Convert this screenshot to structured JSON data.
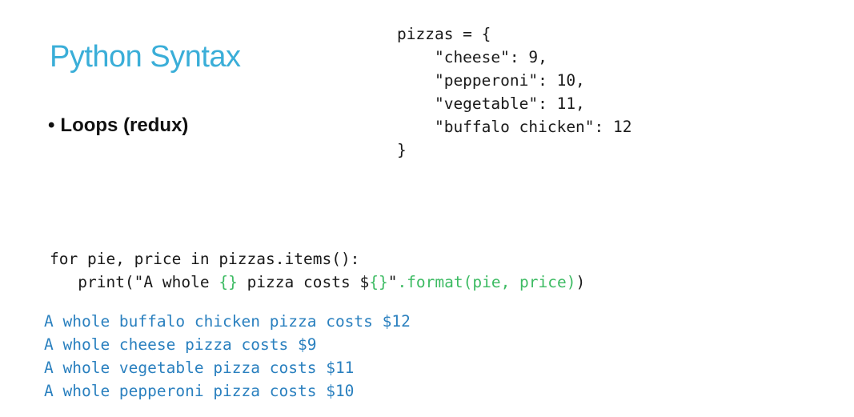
{
  "slide": {
    "title": "Python Syntax",
    "bullet": {
      "marker": "•",
      "text": "Loops (redux)"
    },
    "dict_code": [
      "pizzas = {",
      "    \"cheese\": 9,",
      "    \"pepperoni\": 10,",
      "    \"vegetable\": 11,",
      "    \"buffalo chicken\": 12",
      "}"
    ],
    "loop_code": {
      "line1": "for pie, price in pizzas.items():",
      "line2_indent": "   ",
      "line2_part1": "print(\"A whole ",
      "line2_brace1": "{}",
      "line2_part2": " pizza costs $",
      "line2_brace2": "{}",
      "line2_part3": "\"",
      "line2_method": ".format(pie, price)",
      "line2_part4": ")"
    },
    "output_lines": [
      "A whole buffalo chicken pizza costs $12",
      "A whole cheese pizza costs $9",
      "A whole vegetable pizza costs $11",
      "A whole pepperoni pizza costs $10"
    ]
  }
}
